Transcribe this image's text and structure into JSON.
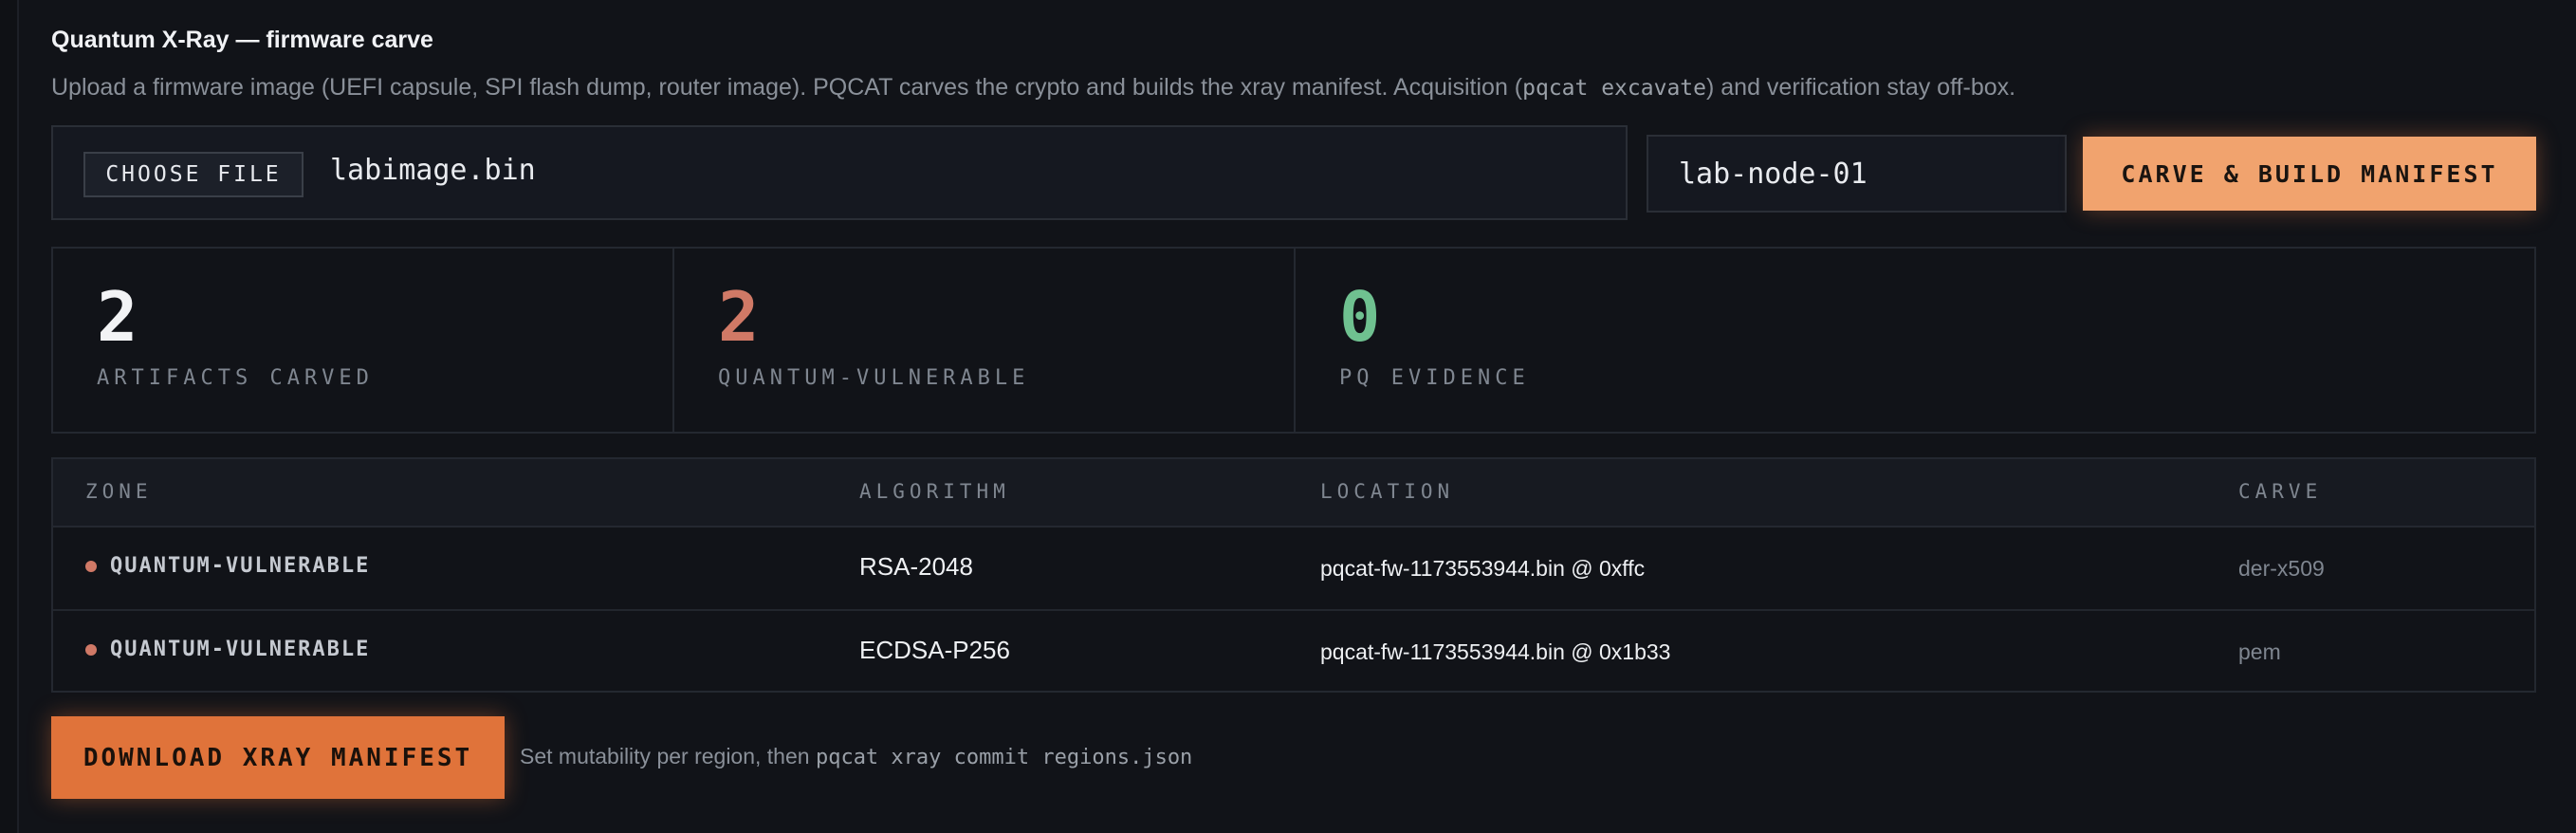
{
  "header": {
    "title": "Quantum X-Ray — firmware carve",
    "subtitle_prefix": "Upload a firmware image (UEFI capsule, SPI flash dump, router image). PQCAT carves the crypto and builds the xray manifest. Acquisition (",
    "subtitle_code": "pqcat excavate",
    "subtitle_suffix": ") and verification stay off-box."
  },
  "upload": {
    "choose_label": "CHOOSE FILE",
    "file_name": "labimage.bin",
    "node_value": "lab-node-01",
    "carve_label": "CARVE & BUILD MANIFEST"
  },
  "stats": [
    {
      "value": "2",
      "label": "ARTIFACTS CARVED",
      "color": "#f2f3f5"
    },
    {
      "value": "2",
      "label": "QUANTUM-VULNERABLE",
      "color": "#d07966"
    },
    {
      "value": "0",
      "label": "PQ EVIDENCE",
      "color": "#6fc190"
    }
  ],
  "table": {
    "headers": [
      "ZONE",
      "ALGORITHM",
      "LOCATION",
      "CARVE"
    ],
    "rows": [
      {
        "zone": "QUANTUM-VULNERABLE",
        "algorithm": "RSA-2048",
        "location": "pqcat-fw-1173553944.bin @ 0xffc",
        "carve": "der-x509"
      },
      {
        "zone": "QUANTUM-VULNERABLE",
        "algorithm": "ECDSA-P256",
        "location": "pqcat-fw-1173553944.bin @ 0x1b33",
        "carve": "pem"
      }
    ]
  },
  "footer": {
    "download_label": "DOWNLOAD XRAY MANIFEST",
    "hint_prefix": "Set mutability per region, then ",
    "hint_code": "pqcat xray commit regions.json"
  },
  "colors": {
    "accent_light": "#f1a36e",
    "accent": "#e0733a",
    "vulnerable": "#d07966",
    "pq": "#6fc190"
  }
}
